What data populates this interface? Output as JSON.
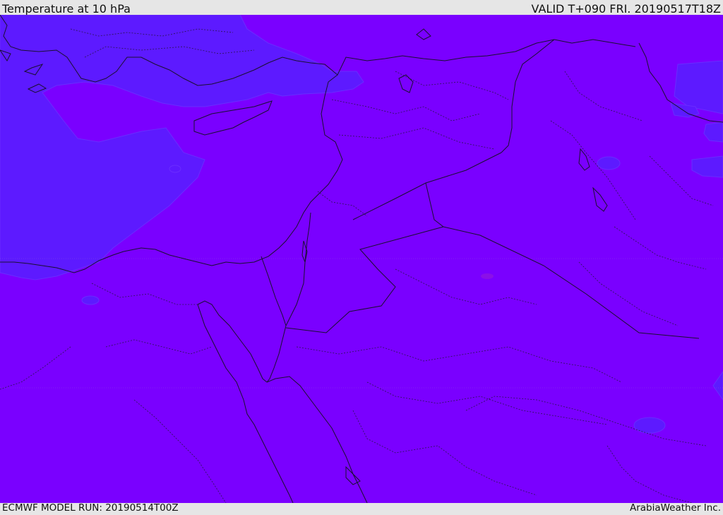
{
  "header": {
    "title": "Temperature at 10 hPa",
    "valid": "VALID T+090 FRI. 20190517T18Z"
  },
  "footer": {
    "model_run": "ECMWF MODEL RUN: 20190514T00Z",
    "credit": "ArabiaWeather Inc."
  },
  "map": {
    "colors": {
      "fill_warm": "#7a00ff",
      "fill_cool": "#5d1aff",
      "coast": "#1a1030",
      "border": "#1a1030",
      "grid": "#9a6bd8"
    }
  }
}
